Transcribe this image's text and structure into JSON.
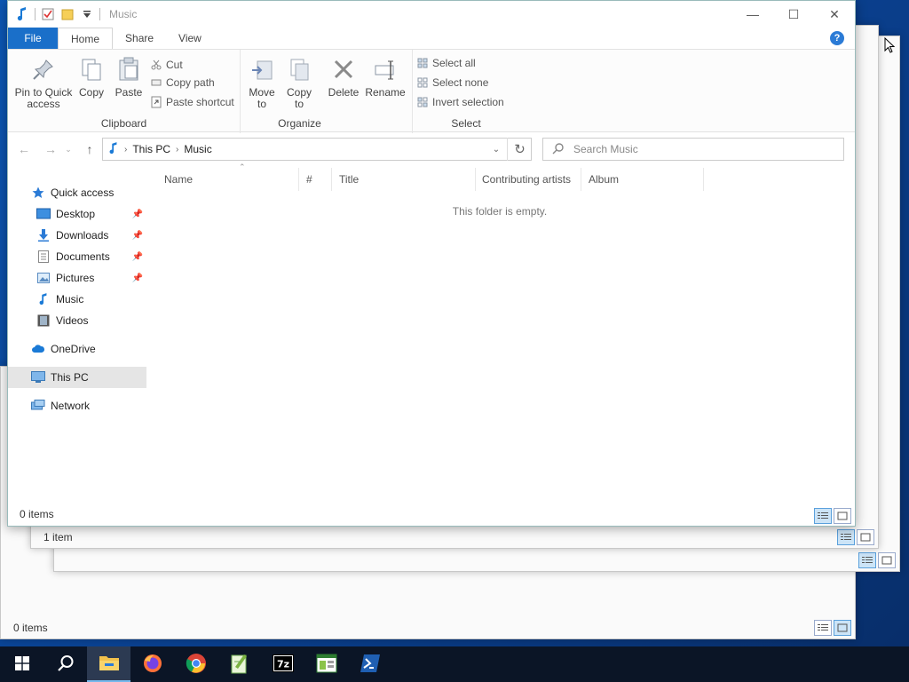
{
  "window": {
    "title": "Music",
    "caption": {
      "minimize": "—",
      "maximize": "☐",
      "close": "✕"
    }
  },
  "ribbon": {
    "tabs": [
      {
        "label": "File"
      },
      {
        "label": "Home"
      },
      {
        "label": "Share"
      },
      {
        "label": "View"
      }
    ],
    "help": "?",
    "clipboard": {
      "label": "Clipboard",
      "pin_line1": "Pin to Quick",
      "pin_line2": "access",
      "copy": "Copy",
      "paste": "Paste",
      "cut": "Cut",
      "copy_path": "Copy path",
      "paste_shortcut": "Paste shortcut"
    },
    "organize": {
      "label": "Organize",
      "move_line1": "Move",
      "move_line2": "to",
      "copy_line1": "Copy",
      "copy_line2": "to",
      "delete": "Delete",
      "rename": "Rename"
    },
    "select": {
      "label": "Select",
      "select_all": "Select all",
      "select_none": "Select none",
      "invert": "Invert selection"
    }
  },
  "address": {
    "crumbs": [
      "This PC",
      "Music"
    ],
    "search_placeholder": "Search Music"
  },
  "nav": {
    "items": [
      {
        "label": "Quick access"
      },
      {
        "label": "Desktop"
      },
      {
        "label": "Downloads"
      },
      {
        "label": "Documents"
      },
      {
        "label": "Pictures"
      },
      {
        "label": "Music"
      },
      {
        "label": "Videos"
      },
      {
        "label": "OneDrive"
      },
      {
        "label": "This PC"
      },
      {
        "label": "Network"
      }
    ]
  },
  "columns": [
    "Name",
    "#",
    "Title",
    "Contributing artists",
    "Album"
  ],
  "empty_message": "This folder is empty.",
  "status": {
    "main": "0 items",
    "bg1": "1 item",
    "bg3": "0 items"
  },
  "taskbar": {
    "items": [
      {
        "icon": "windows-logo-icon"
      },
      {
        "icon": "search-icon"
      },
      {
        "icon": "file-explorer-icon"
      },
      {
        "icon": "firefox-icon"
      },
      {
        "icon": "chrome-icon"
      },
      {
        "icon": "notepad-plus-icon"
      },
      {
        "icon": "7zip-icon"
      },
      {
        "icon": "app-window-icon"
      },
      {
        "icon": "powershell-icon"
      }
    ]
  },
  "colors": {
    "accent": "#1a6fc9",
    "desktop": "#0b57b4",
    "taskbar": "#0b1526"
  }
}
